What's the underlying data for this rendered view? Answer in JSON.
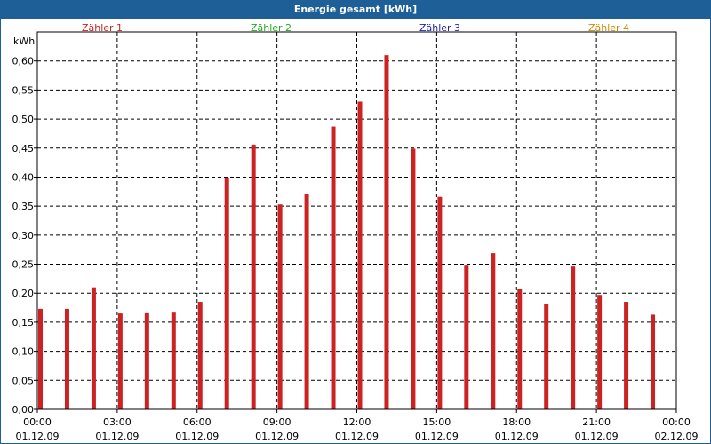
{
  "chart_data": {
    "type": "bar",
    "title": "Energie gesamt [kWh]",
    "ylabel": "kWh",
    "ylim": [
      0,
      0.65
    ],
    "yticks": [
      "0,00",
      "0,05",
      "0,10",
      "0,15",
      "0,20",
      "0,25",
      "0,30",
      "0,35",
      "0,40",
      "0,45",
      "0,50",
      "0,55",
      "0,60"
    ],
    "xticks": [
      {
        "time": "00:00",
        "date": "01.12.09"
      },
      {
        "time": "03:00",
        "date": "01.12.09"
      },
      {
        "time": "06:00",
        "date": "01.12.09"
      },
      {
        "time": "09:00",
        "date": "01.12.09"
      },
      {
        "time": "12:00",
        "date": "01.12.09"
      },
      {
        "time": "15:00",
        "date": "01.12.09"
      },
      {
        "time": "18:00",
        "date": "01.12.09"
      },
      {
        "time": "21:00",
        "date": "01.12.09"
      },
      {
        "time": "00:00",
        "date": "02.12.09"
      }
    ],
    "x_hours": [
      0,
      1,
      2,
      3,
      4,
      5,
      6,
      7,
      8,
      9,
      10,
      11,
      12,
      13,
      14,
      15,
      16,
      17,
      18,
      19,
      20,
      21,
      22,
      23
    ],
    "series": [
      {
        "name": "Zähler 1",
        "color": "#cc2222",
        "values": [
          0.173,
          0.173,
          0.21,
          0.165,
          0.167,
          0.168,
          0.185,
          0.398,
          0.456,
          0.353,
          0.371,
          0.487,
          0.53,
          0.61,
          0.449,
          0.366,
          0.249,
          0.269,
          0.207,
          0.182,
          0.246,
          0.197,
          0.185,
          0.163
        ]
      },
      {
        "name": "Zähler 2",
        "color": "#22aa22",
        "values": []
      },
      {
        "name": "Zähler 3",
        "color": "#2222aa",
        "values": []
      },
      {
        "name": "Zähler 4",
        "color": "#cc8800",
        "values": []
      }
    ],
    "grid": true
  }
}
